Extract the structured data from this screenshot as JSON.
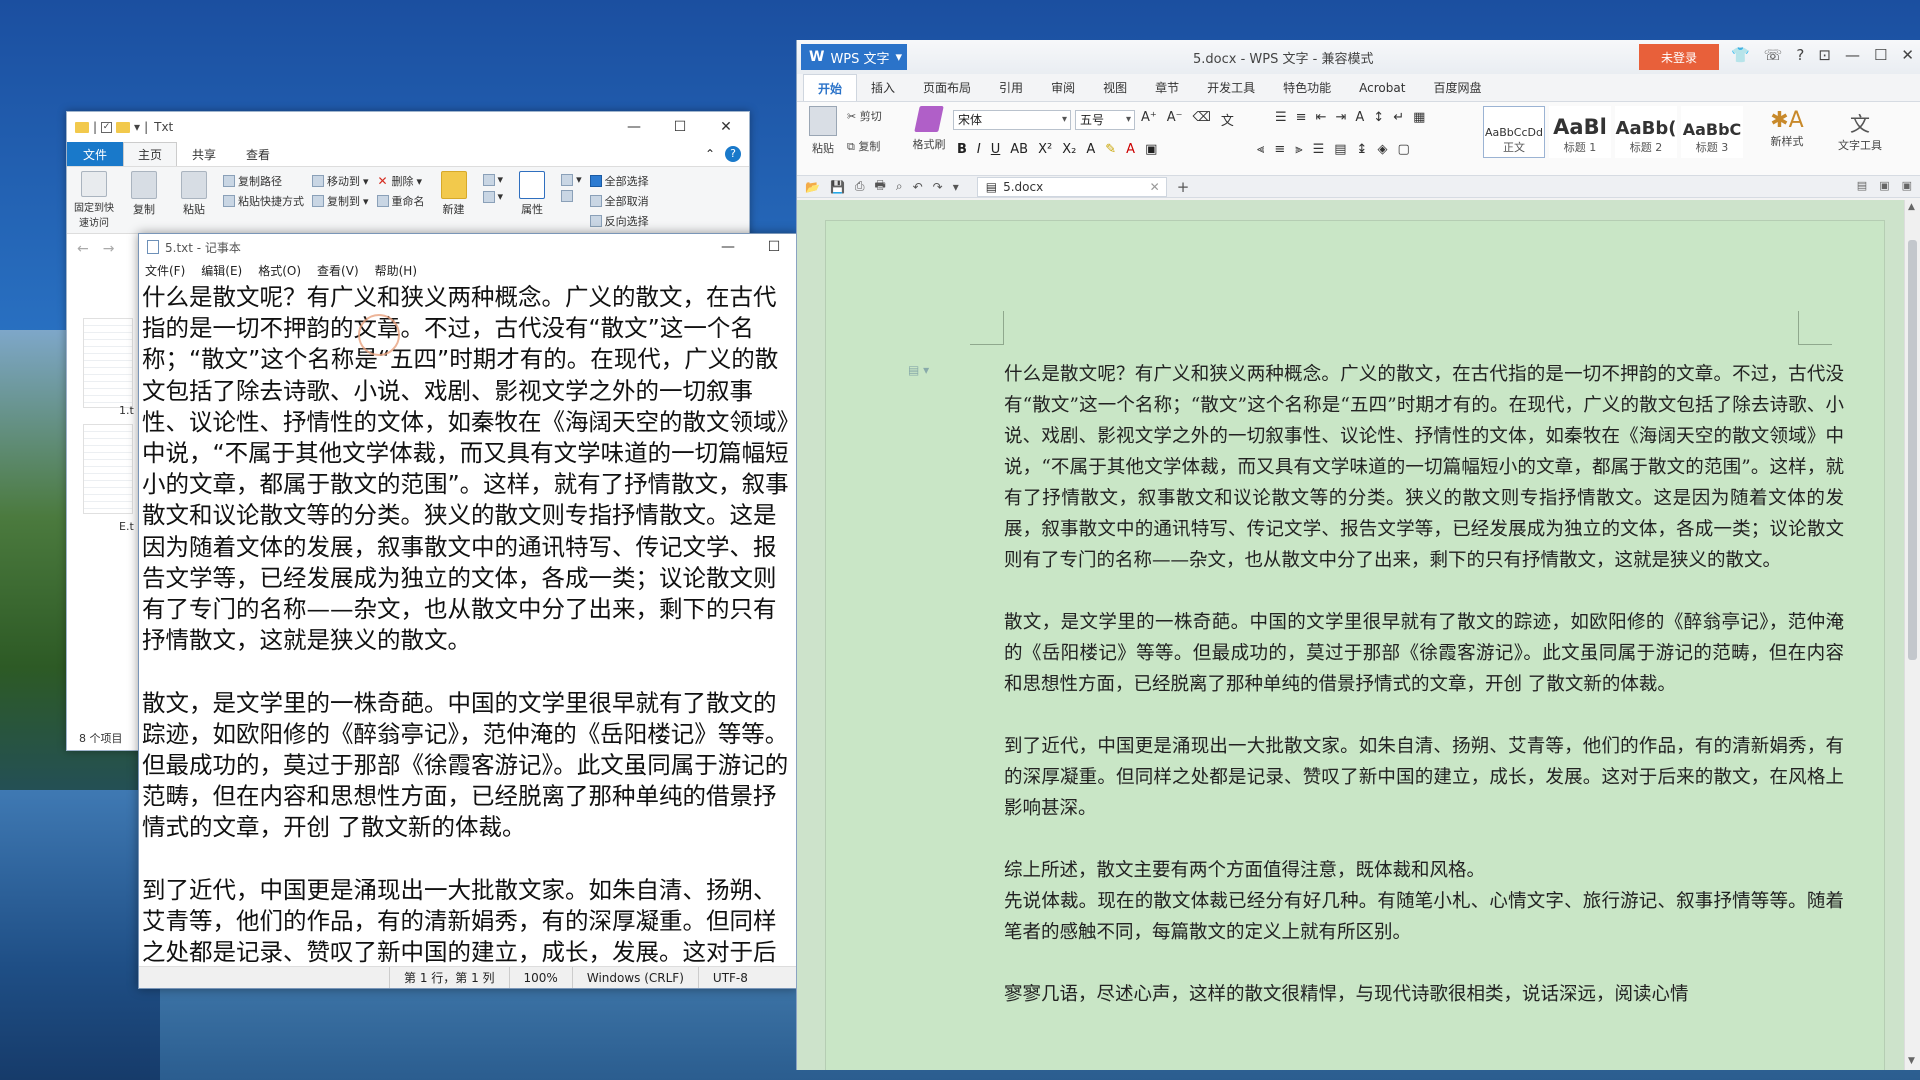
{
  "explorer": {
    "title": "Txt",
    "tabs": {
      "file": "文件",
      "home": "主页",
      "share": "共享",
      "view": "查看"
    },
    "ribbon": {
      "pin": "固定到快速访问",
      "copy": "复制",
      "paste": "粘贴",
      "copy_path": "复制路径",
      "paste_shortcut": "粘贴快捷方式",
      "move_to": "移动到",
      "delete": "删除",
      "copy_to": "复制到",
      "rename": "重命名",
      "new": "新建",
      "properties": "属性",
      "select_all": "全部选择",
      "select_none": "全部取消",
      "invert_selection": "反向选择"
    },
    "files": [
      {
        "label": "1.t"
      },
      {
        "label": "E.t"
      }
    ],
    "status": "8 个项目"
  },
  "notepad": {
    "title": "5.txt - 记事本",
    "menu": [
      "文件(F)",
      "编辑(E)",
      "格式(O)",
      "查看(V)",
      "帮助(H)"
    ],
    "text": "什么是散文呢？有广义和狭义两种概念。广义的散文，在古代指的是一切不押韵的文章。不过，古代没有“散文”这一个名称；“散文”这个名称是“五四”时期才有的。在现代，广义的散文包括了除去诗歌、小说、戏剧、影视文学之外的一切叙事性、议论性、抒情性的文体，如秦牧在《海阔天空的散文领域》中说，“不属于其他文学体裁，而又具有文学味道的一切篇幅短小的文章，都属于散文的范围”。这样，就有了抒情散文，叙事散文和议论散文等的分类。狭义的散文则专指抒情散文。这是因为随着文体的发展，叙事散文中的通讯特写、传记文学、报告文学等，已经发展成为独立的文体，各成一类；议论散文则有了专门的名称——杂文，也从散文中分了出来，剩下的只有抒情散文，这就是狭义的散文。\n\n散文，是文学里的一株奇葩。中国的文学里很早就有了散文的踪迹，如欧阳修的《醉翁亭记》，范仲淹的《岳阳楼记》等等。但最成功的，莫过于那部《徐霞客游记》。此文虽同属于游记的范畴，但在内容和思想性方面，已经脱离了那种单纯的借景抒情式的文章，开创 了散文新的体裁。\n\n到了近代，中国更是涌现出一大批散文家。如朱自清、扬朔、艾青等，他们的作品，有的清新娟秀，有的深厚凝重。但同样之处都是记录、赞叹了新中国的建立，成长，发展。这对于后",
    "status": {
      "position": "第 1 行，第 1 列",
      "zoom": "100%",
      "line_ending": "Windows (CRLF)",
      "encoding": "UTF-8"
    }
  },
  "wps": {
    "app_name": "WPS 文字",
    "doc_title": "5.docx - WPS 文字 - 兼容模式",
    "login": "未登录",
    "tabs": [
      "开始",
      "插入",
      "页面布局",
      "引用",
      "审阅",
      "视图",
      "章节",
      "开发工具",
      "特色功能",
      "Acrobat",
      "百度网盘"
    ],
    "ribbon": {
      "paste": "粘贴",
      "cut": "剪切",
      "copy": "复制",
      "format_painter": "格式刷",
      "font": "宋体",
      "size": "五号",
      "styles": [
        {
          "preview": "AaBbCcDd",
          "name": "正文"
        },
        {
          "preview": "AaBl",
          "name": "标题 1"
        },
        {
          "preview": "AaBb(",
          "name": "标题 2"
        },
        {
          "preview": "AaBbC",
          "name": "标题 3"
        }
      ],
      "new_style": "新样式",
      "text_tools": "文字工具"
    },
    "doc_tab": "5.docx",
    "paragraphs": [
      "什么是散文呢？有广义和狭义两种概念。广义的散文，在古代指的是一切不押韵的文章。不过，古代没有“散文”这一个名称；“散文”这个名称是“五四”时期才有的。在现代，广义的散文包括了除去诗歌、小说、戏剧、影视文学之外的一切叙事性、议论性、抒情性的文体，如秦牧在《海阔天空的散文领域》中说，“不属于其他文学体裁，而又具有文学味道的一切篇幅短小的文章，都属于散文的范围”。这样，就有了抒情散文，叙事散文和议论散文等的分类。狭义的散文则专指抒情散文。这是因为随着文体的发展，叙事散文中的通讯特写、传记文学、报告文学等，已经发展成为独立的文体，各成一类；议论散文则有了专门的名称——杂文，也从散文中分了出来，剩下的只有抒情散文，这就是狭义的散文。",
      "散文，是文学里的一株奇葩。中国的文学里很早就有了散文的踪迹，如欧阳修的《醉翁亭记》，范仲淹的《岳阳楼记》等等。但最成功的，莫过于那部《徐霞客游记》。此文虽同属于游记的范畴，但在内容和思想性方面，已经脱离了那种单纯的借景抒情式的文章，开创 了散文新的体裁。",
      "到了近代，中国更是涌现出一大批散文家。如朱自清、扬朔、艾青等，他们的作品，有的清新娟秀，有的深厚凝重。但同样之处都是记录、赞叹了新中国的建立，成长，发展。这对于后来的散文，在风格上影响甚深。",
      "综上所述，散文主要有两个方面值得注意，既体裁和风格。",
      "先说体裁。现在的散文体裁已经分有好几种。有随笔小札、心情文字、旅行游记、叙事抒情等等。随着笔者的感触不同，每篇散文的定义上就有所区别。",
      "寥寥几语，尽述心声，这样的散文很精悍，与现代诗歌很相类，说话深远，阅读心情"
    ]
  }
}
